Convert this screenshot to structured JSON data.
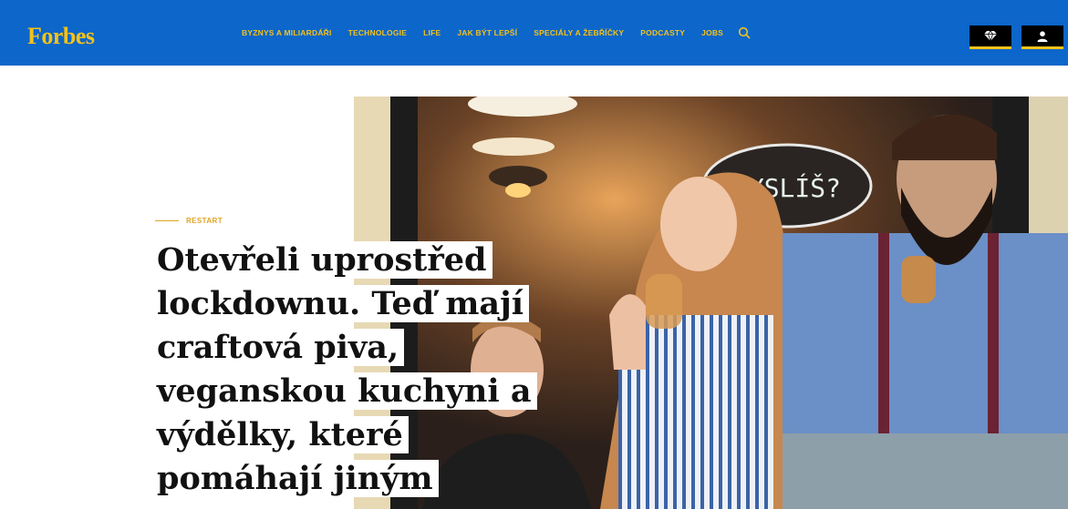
{
  "header": {
    "logo": "Forbes",
    "menu": [
      "BYZNYS A MILIARDÁŘI",
      "TECHNOLOGIE",
      "LIFE",
      "JAK BÝT LEPŠÍ",
      "SPECIÁLY A ŽEBŘÍČKY",
      "PODCASTY",
      "JOBS"
    ],
    "icons": [
      "search-icon",
      "diamond-icon",
      "user-icon"
    ],
    "colors": {
      "bar": "#0d66c9",
      "accent": "#f4c21b"
    }
  },
  "article": {
    "category": "RESTART",
    "title": "Otevřeli uprostřed lockdownu. Teď mají craftová piva, veganskou kuchyni a výdělky, které pomáhají jiným",
    "photo_sign_text": "MYSLÍŠ?"
  }
}
